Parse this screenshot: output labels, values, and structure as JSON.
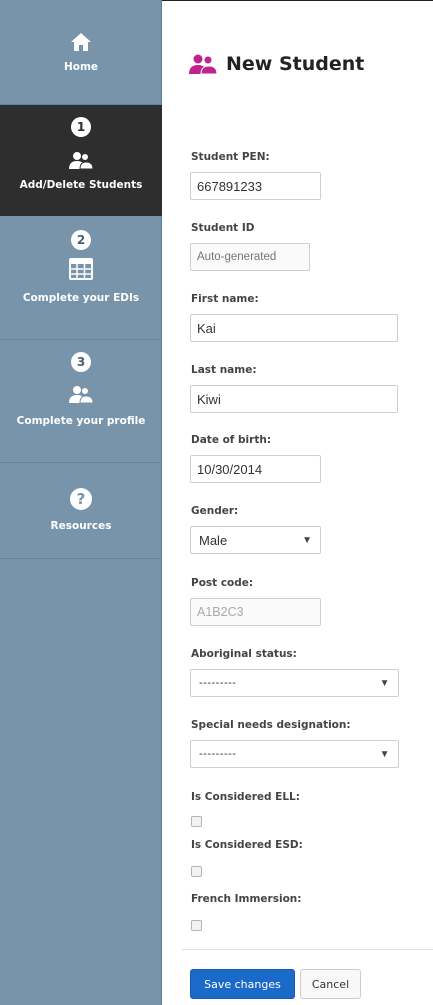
{
  "sidebar": {
    "items": [
      {
        "label": "Home",
        "icon": "home-icon",
        "step": ""
      },
      {
        "label": "Add/Delete Students",
        "icon": "users-icon",
        "step": "1"
      },
      {
        "label": "Complete your EDIs",
        "icon": "table-icon",
        "step": "2"
      },
      {
        "label": "Complete your profile",
        "icon": "users-icon",
        "step": "3"
      },
      {
        "label": "Resources",
        "icon": "question-icon",
        "step": ""
      }
    ]
  },
  "page": {
    "title": "New Student",
    "title_icon_color": "#c0228f"
  },
  "form": {
    "student_pen": {
      "label": "Student PEN:",
      "value": "667891233"
    },
    "student_id": {
      "label": "Student ID",
      "placeholder": "Auto-generated"
    },
    "first_name": {
      "label": "First name:",
      "value": "Kai"
    },
    "last_name": {
      "label": "Last name:",
      "value": "Kiwi"
    },
    "dob": {
      "label": "Date of birth:",
      "value": "10/30/2014"
    },
    "gender": {
      "label": "Gender:",
      "selected": "Male"
    },
    "post_code": {
      "label": "Post code:",
      "value": "A1B2C3"
    },
    "aboriginal": {
      "label": "Aboriginal status:",
      "selected": "---------"
    },
    "special_needs": {
      "label": "Special needs designation:",
      "selected": "---------"
    },
    "ell": {
      "label": "Is Considered ELL:",
      "checked": false
    },
    "esd": {
      "label": "Is Considered ESD:",
      "checked": false
    },
    "french": {
      "label": "French Immersion:",
      "checked": false
    }
  },
  "actions": {
    "save_label": "Save changes",
    "cancel_label": "Cancel",
    "primary_color": "#1b6ac9"
  }
}
